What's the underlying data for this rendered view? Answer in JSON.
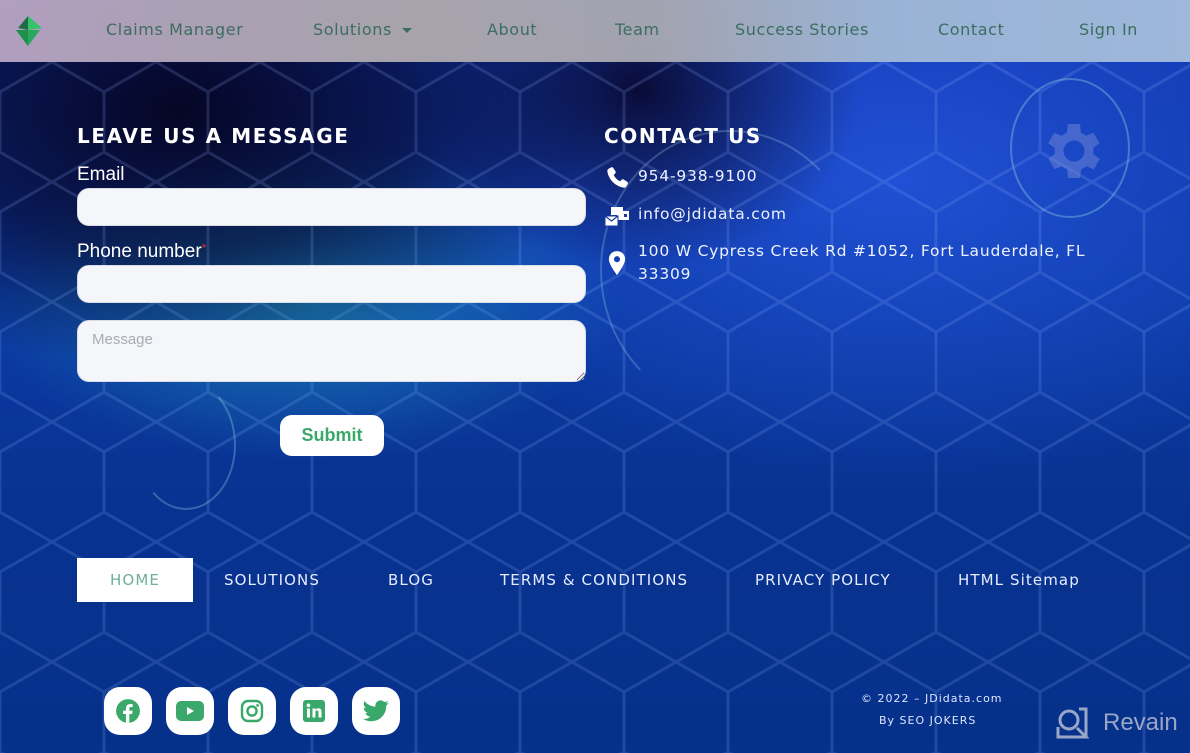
{
  "nav": {
    "items": [
      {
        "label": "Claims Manager"
      },
      {
        "label": "Solutions",
        "has_dropdown": true
      },
      {
        "label": "About"
      },
      {
        "label": "Team"
      },
      {
        "label": "Success Stories"
      },
      {
        "label": "Contact"
      },
      {
        "label": "Sign In"
      }
    ]
  },
  "form": {
    "heading": "LEAVE US A MESSAGE",
    "email_label": "Email",
    "email_value": "",
    "phone_label": "Phone number",
    "phone_required_mark": "*",
    "phone_value": "",
    "message_placeholder": "Message",
    "message_value": "",
    "submit_label": "Submit"
  },
  "contact": {
    "heading": "CONTACT US",
    "phone": "954-938-9100",
    "email": "info@jdidata.com",
    "address_line1": "100 W Cypress Creek Rd #1052, Fort Lauderdale, FL",
    "address_line2": "33309"
  },
  "footer_nav": {
    "items": [
      {
        "label": "HOME",
        "active": true
      },
      {
        "label": "SOLUTIONS"
      },
      {
        "label": "BLOG"
      },
      {
        "label": "TERMS & CONDITIONS"
      },
      {
        "label": "PRIVACY POLICY"
      },
      {
        "label": "HTML Sitemap"
      }
    ]
  },
  "social": {
    "items": [
      {
        "name": "facebook"
      },
      {
        "name": "youtube"
      },
      {
        "name": "instagram"
      },
      {
        "name": "linkedin"
      },
      {
        "name": "twitter"
      }
    ]
  },
  "footer": {
    "copyright": "© 2022 – JDidata.com",
    "credit": "By SEO JOKERS",
    "watermark": "Revain"
  },
  "colors": {
    "accent_green": "#3aa86a",
    "nav_text": "#3c6d60",
    "background_blue": "#0a2f8c"
  }
}
